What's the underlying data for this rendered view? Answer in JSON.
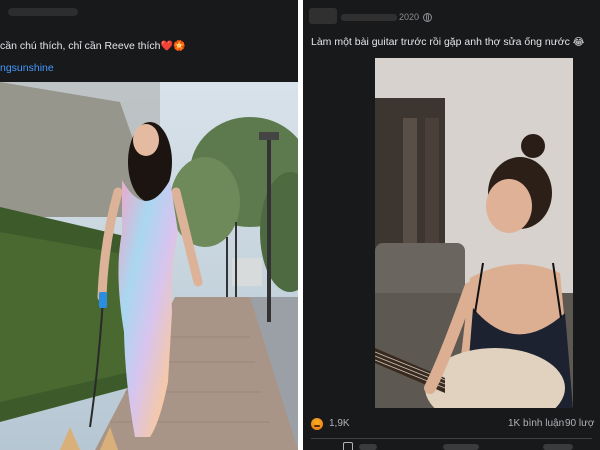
{
  "left_post": {
    "caption": "cần chú thích, chỉ cần Reeve thích",
    "caption_emoji": "❤️🏵️",
    "hashtag": "ngsunshine"
  },
  "right_post": {
    "date_visible": "2020",
    "caption": "Làm một bài guitar trước rồi gặp anh thợ sửa ống nước",
    "caption_emoji": "😂",
    "reaction_count": "1,9K",
    "comment_count": "1K bình luận",
    "share_count": "90 lượ"
  },
  "colors": {
    "panel_bg": "#18191a",
    "text_primary": "#e4e6eb",
    "text_secondary": "#b0b3b8",
    "link": "#4599ff",
    "angry_reaction": "#e9710f"
  }
}
